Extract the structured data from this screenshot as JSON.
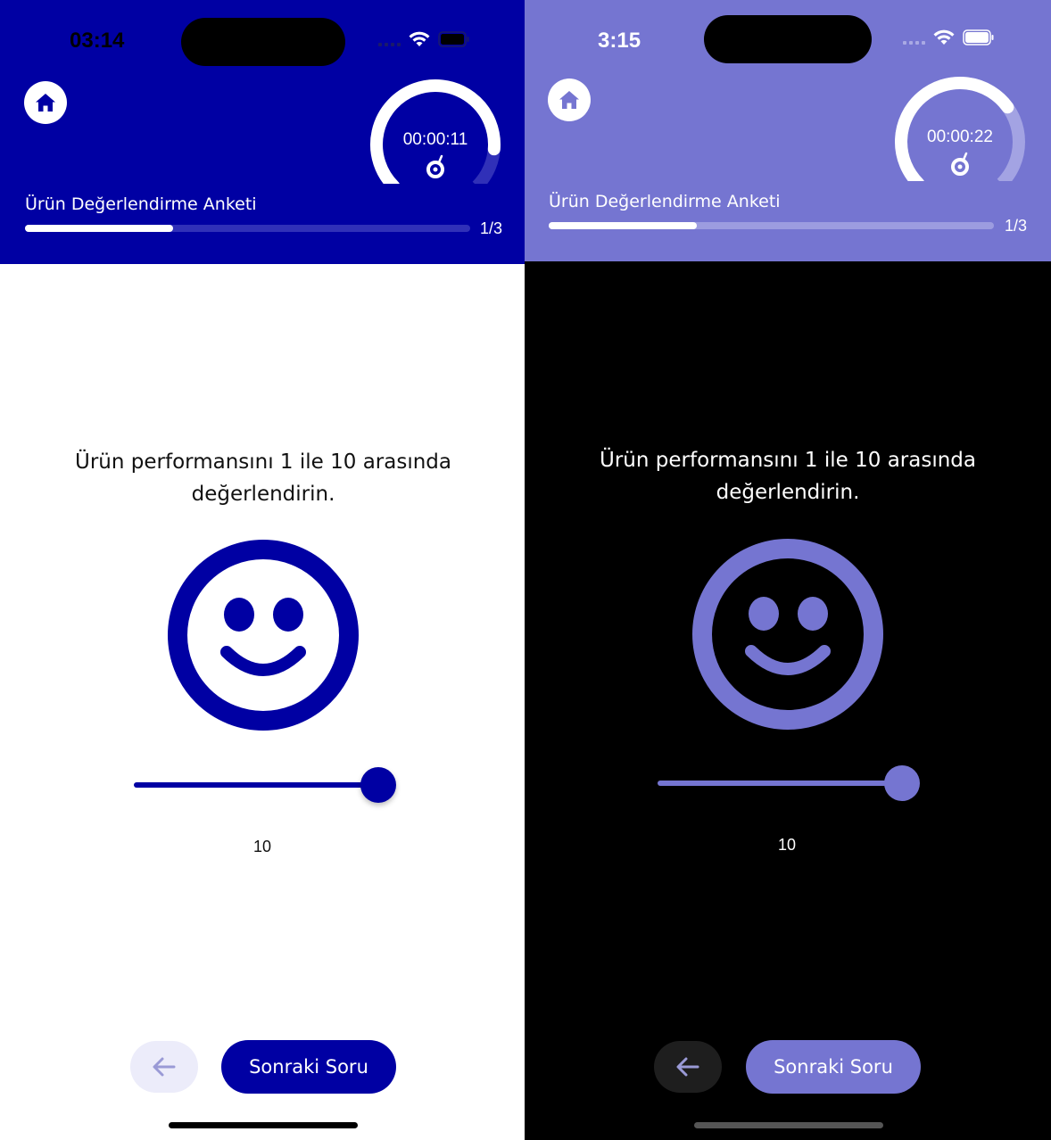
{
  "light": {
    "status": {
      "time": "03:14"
    },
    "timer": {
      "text": "00:00:11",
      "progress": 0.85
    },
    "survey": {
      "title": "Ürün Değerlendirme Anketi",
      "progress_current": 1,
      "progress_total": 3,
      "progress_label": "1/3",
      "progress_fraction": 0.333
    },
    "question": {
      "text": "Ürün performansını 1 ile 10 arasında değerlendirin."
    },
    "slider": {
      "value": 10,
      "min": 1,
      "max": 10,
      "value_label": "10"
    },
    "buttons": {
      "next_label": "Sonraki Soru"
    },
    "colors": {
      "primary": "#0000A3",
      "background": "#ffffff",
      "text": "#111111"
    }
  },
  "dark": {
    "status": {
      "time": "3:15"
    },
    "timer": {
      "text": "00:00:22",
      "progress": 0.7
    },
    "survey": {
      "title": "Ürün Değerlendirme Anketi",
      "progress_current": 1,
      "progress_total": 3,
      "progress_label": "1/3",
      "progress_fraction": 0.333
    },
    "question": {
      "text": "Ürün performansını 1 ile 10 arasında değerlendirin."
    },
    "slider": {
      "value": 10,
      "min": 1,
      "max": 10,
      "value_label": "10"
    },
    "buttons": {
      "next_label": "Sonraki Soru"
    },
    "colors": {
      "primary": "#7575D1",
      "background": "#000000",
      "text": "#ffffff"
    }
  },
  "icons": {
    "home": "home-icon",
    "back": "arrow-left-icon",
    "wifi": "wifi-icon",
    "battery": "battery-icon",
    "signal": "signal-icon",
    "timer_knob": "dial-icon",
    "smiley": "smiley-face-icon"
  }
}
